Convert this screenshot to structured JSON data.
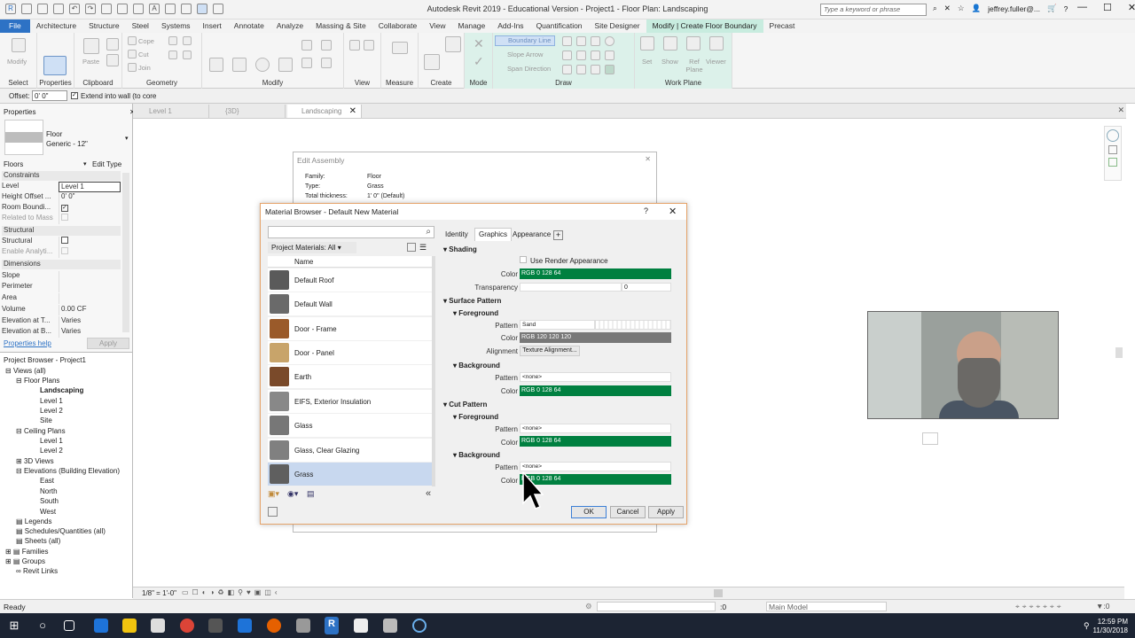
{
  "app": {
    "title": "Autodesk Revit 2019 - Educational Version - Project1 - Floor Plan: Landscaping",
    "search_placeholder": "Type a keyword or phrase",
    "user": "jeffrey.fuller@..."
  },
  "ribbon_tabs": [
    "File",
    "Architecture",
    "Structure",
    "Steel",
    "Systems",
    "Insert",
    "Annotate",
    "Analyze",
    "Massing & Site",
    "Collaborate",
    "View",
    "Manage",
    "Add-Ins",
    "Quantification",
    "Site Designer",
    "Modify | Create Floor Boundary",
    "Precast"
  ],
  "ribbon": {
    "modify_label": "Modify",
    "paste_label": "Paste",
    "cope_label": "Cope",
    "cut_label": "Cut",
    "join_label": "Join",
    "boundary_line": "Boundary Line",
    "slope_arrow": "Slope Arrow",
    "span_direction": "Span Direction",
    "set_label": "Set",
    "show_label": "Show",
    "ref_plane_label": "Ref Plane",
    "viewer_label": "Viewer",
    "panels": [
      "Select",
      "Properties",
      "Clipboard",
      "Geometry",
      "Modify",
      "View",
      "Measure",
      "Create",
      "Mode",
      "Draw",
      "Work Plane"
    ]
  },
  "options_bar": {
    "offset_label": "Offset:",
    "offset_value": "0' 0\"",
    "extend_label": "Extend into wall (to core"
  },
  "properties": {
    "header": "Properties",
    "type_family": "Floor",
    "type_name": "Generic - 12\"",
    "category": "Floors",
    "edit_type": "Edit Type",
    "groups": {
      "constraints": "Constraints",
      "structural": "Structural",
      "dimensions": "Dimensions"
    },
    "rows": [
      {
        "k": "Level",
        "v": "Level 1"
      },
      {
        "k": "Height Offset ...",
        "v": "0' 0\""
      },
      {
        "k": "Room Boundi...",
        "v": ""
      },
      {
        "k": "Related to Mass",
        "v": ""
      },
      {
        "k": "Structural",
        "v": ""
      },
      {
        "k": "Enable Analyti...",
        "v": ""
      },
      {
        "k": "Slope",
        "v": ""
      },
      {
        "k": "Perimeter",
        "v": ""
      },
      {
        "k": "Area",
        "v": ""
      },
      {
        "k": "Volume",
        "v": "0.00 CF"
      },
      {
        "k": "Elevation at T...",
        "v": "Varies"
      },
      {
        "k": "Elevation at B...",
        "v": "Varies"
      }
    ],
    "help": "Properties help",
    "apply": "Apply"
  },
  "project_browser": {
    "header": "Project Browser - Project1",
    "items": [
      "Views (all)",
      "Floor Plans",
      "Landscaping",
      "Level 1",
      "Level 2",
      "Site",
      "Ceiling Plans",
      "Level 1",
      "Level 2",
      "3D Views",
      "Elevations (Building Elevation)",
      "East",
      "North",
      "South",
      "West",
      "Legends",
      "Schedules/Quantities (all)",
      "Sheets (all)",
      "Families",
      "Groups",
      "Revit Links"
    ]
  },
  "view_tabs": [
    "Level 1",
    "{3D}",
    "Landscaping"
  ],
  "edit_assembly": {
    "title": "Edit Assembly",
    "family_label": "Family:",
    "family": "Floor",
    "type_label": "Type:",
    "type": "Grass",
    "thickness_label": "Total thickness:",
    "thickness": "1'  0\" (Default)"
  },
  "material_browser": {
    "title": "Material Browser - Default New Material",
    "filter": "Project Materials: All",
    "column": "Name",
    "materials": [
      "Default Roof",
      "Default Wall",
      "Door - Frame",
      "Door - Panel",
      "Earth",
      "EIFS, Exterior Insulation",
      "Glass",
      "Glass, Clear Glazing",
      "Grass"
    ],
    "selected": "Grass",
    "tabs": [
      "Identity",
      "Graphics",
      "Appearance"
    ],
    "shading": {
      "title": "Shading",
      "use_render": "Use Render Appearance",
      "color_label": "Color",
      "color": "RGB 0 128 64",
      "transparency_label": "Transparency",
      "transparency": "0"
    },
    "surface": {
      "title": "Surface Pattern",
      "fg": "Foreground",
      "pattern_label": "Pattern",
      "fg_pattern": "Sand",
      "color_label": "Color",
      "fg_color": "RGB 120 120 120",
      "alignment_label": "Alignment",
      "alignment": "Texture Alignment...",
      "bg": "Background",
      "bg_pattern": "<none>",
      "bg_color": "RGB 0 128 64"
    },
    "cut": {
      "title": "Cut Pattern",
      "fg": "Foreground",
      "fg_pattern": "<none>",
      "fg_color": "RGB 0 128 64",
      "bg": "Background",
      "bg_pattern": "<none>",
      "bg_color": "RGB 0 128 64"
    },
    "buttons": {
      "ok": "OK",
      "cancel": "Cancel",
      "apply": "Apply"
    }
  },
  "view_bar": {
    "scale": "1/8\" = 1'-0\""
  },
  "status": {
    "ready": "Ready",
    "zero": ":0",
    "model": "Main Model"
  },
  "clock": {
    "time": "12:59 PM",
    "date": "11/30/2018"
  },
  "colors": {
    "green": "#008040",
    "gray": "#787878",
    "accent": "#2d72c5",
    "context_tab": "#c8ecdf"
  }
}
